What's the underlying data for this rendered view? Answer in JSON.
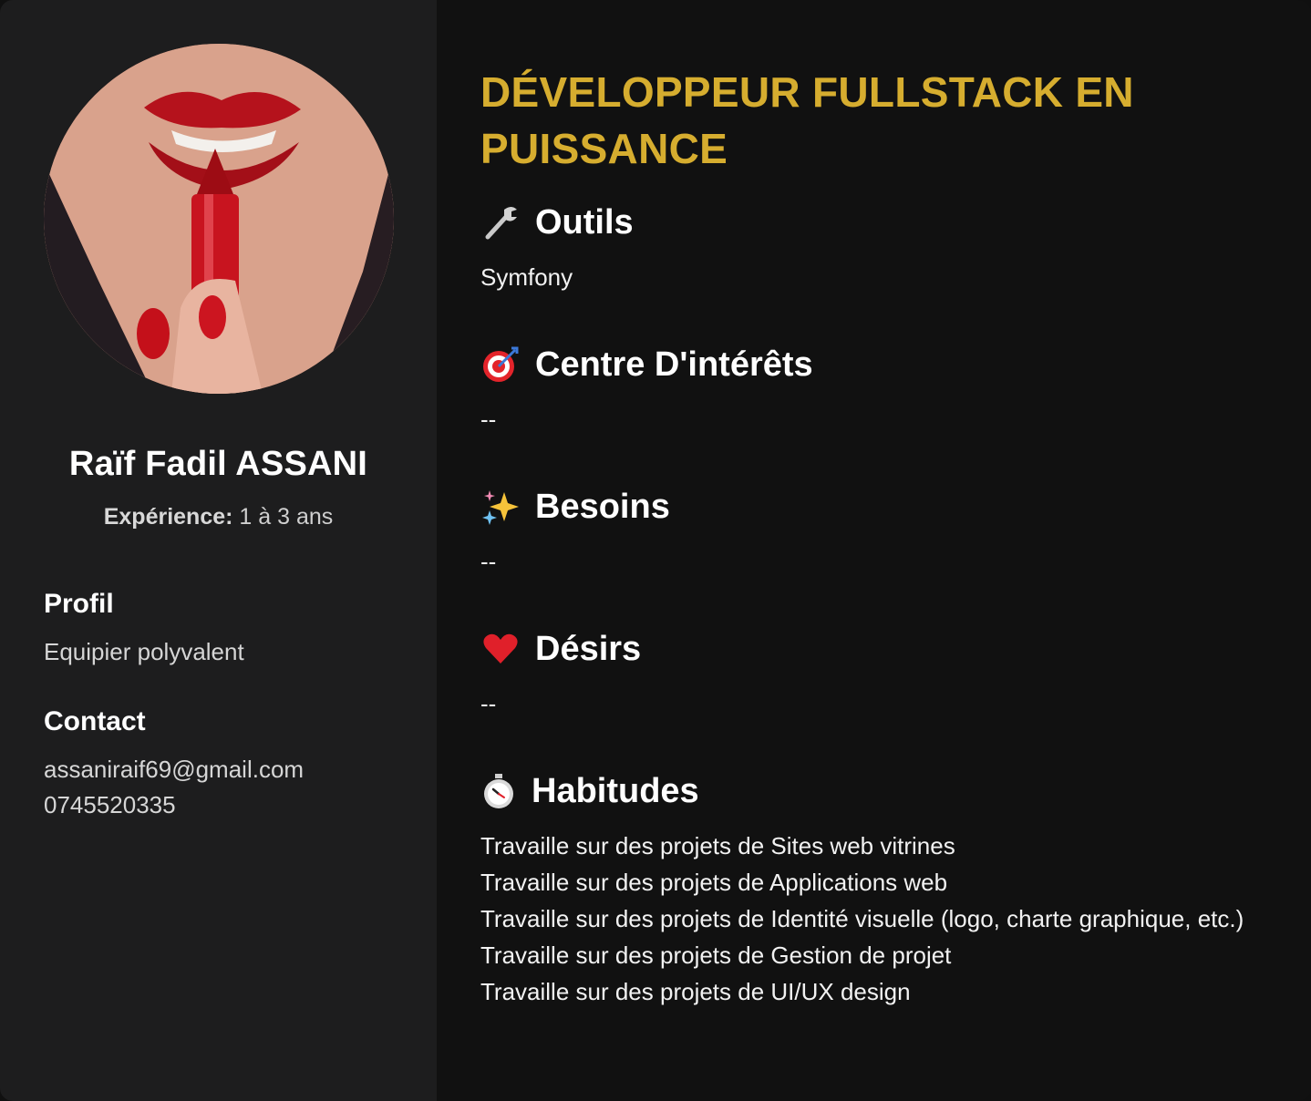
{
  "profile": {
    "name": "Raïf Fadil ASSANI",
    "experience_label": "Expérience:",
    "experience_value": "1 à 3 ans",
    "profil_heading": "Profil",
    "profil_value": "Equipier polyvalent",
    "contact_heading": "Contact",
    "email": "assaniraif69@gmail.com",
    "phone": "0745520335"
  },
  "main": {
    "headline": "DÉVELOPPEUR FULLSTACK EN PUISSANCE",
    "sections": [
      {
        "title": "Outils",
        "icon": "wrench-icon",
        "items": [
          "Symfony"
        ]
      },
      {
        "title": "Centre D'intérêts",
        "icon": "target-icon",
        "items": [
          "--"
        ]
      },
      {
        "title": "Besoins",
        "icon": "sparkles-icon",
        "items": [
          "--"
        ]
      },
      {
        "title": "Désirs",
        "icon": "heart-icon",
        "items": [
          "--"
        ]
      },
      {
        "title": "Habitudes",
        "icon": "stopwatch-icon",
        "items": [
          "Travaille sur des projets de Sites web vitrines",
          "Travaille sur des projets de Applications web",
          "Travaille sur des projets de Identité visuelle (logo, charte graphique, etc.)",
          "Travaille sur des projets de Gestion de projet",
          "Travaille sur des projets de UI/UX design"
        ]
      }
    ]
  },
  "colors": {
    "accent": "#d6ad2f",
    "sidebar_bg": "#1d1d1e",
    "main_bg": "#111111"
  }
}
